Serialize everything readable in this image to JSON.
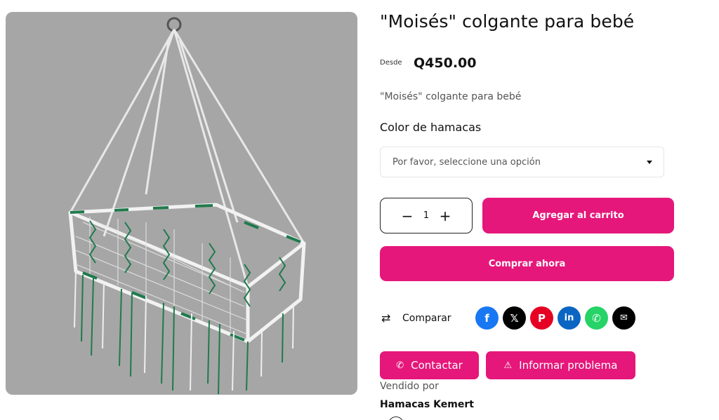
{
  "product": {
    "title": "\"Moisés\" colgante para bebé",
    "price_prefix": "Desde",
    "price": "Q450.00",
    "short_description": "\"Moisés\" colgante para bebé",
    "variant_label": "Color de hamacas",
    "variant_placeholder": "Por favor, seleccione una opción",
    "quantity": "1"
  },
  "actions": {
    "decrease": "−",
    "increase": "+",
    "add_to_cart": "Agregar al carrito",
    "buy_now": "Comprar ahora",
    "compare": "Comparar",
    "contact": "Contactar",
    "report": "Informar problema"
  },
  "share": {
    "icons": [
      "facebook-icon",
      "x-icon",
      "pinterest-icon",
      "linkedin-icon",
      "whatsapp-icon",
      "email-icon"
    ]
  },
  "vendor": {
    "sold_by_label": "Vendido por",
    "name": "Hamacas Kemert"
  },
  "colors": {
    "accent": "#e5177a",
    "image_background": "#a6a6a6",
    "hammock_green": "#1f7a4d"
  }
}
